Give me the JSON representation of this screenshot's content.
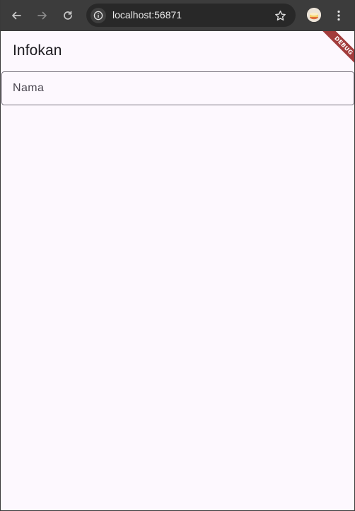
{
  "browser": {
    "url": "localhost:56871",
    "icons": {
      "back": "arrow-left-icon",
      "forward": "arrow-right-icon",
      "reload": "reload-icon",
      "site_info": "info-icon",
      "bookmark": "star-icon",
      "profile": "avatar-icon",
      "menu": "kebab-menu-icon"
    }
  },
  "app": {
    "title": "Infokan",
    "name_field": {
      "label": "Nama",
      "value": ""
    },
    "debug_banner": "DEBUG"
  },
  "colors": {
    "chrome_bg": "#3c3c3c",
    "omnibox_bg": "#282828",
    "page_bg": "#fdf8fe",
    "field_border": "#79747e",
    "debug_banner": "#a23c3c"
  }
}
